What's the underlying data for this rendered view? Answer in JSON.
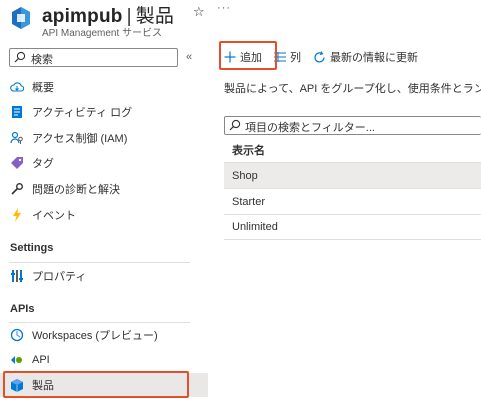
{
  "header": {
    "resource_name": "apimpub",
    "separator": "|",
    "page_name": "製品",
    "subtitle": "API Management サービス",
    "favorite_icon": "star-icon",
    "more_label": "···"
  },
  "sidebar": {
    "search_placeholder": "検索",
    "collapse_label": "«",
    "items_top": [
      {
        "label": "概要",
        "icon": "cloud-icon"
      },
      {
        "label": "アクティビティ ログ",
        "icon": "activity-log-icon"
      },
      {
        "label": "アクセス制御 (IAM)",
        "icon": "iam-icon"
      },
      {
        "label": "タグ",
        "icon": "tag-icon"
      },
      {
        "label": "問題の診断と解決",
        "icon": "wrench-icon"
      },
      {
        "label": "イベント",
        "icon": "lightning-icon"
      }
    ],
    "settings": {
      "heading": "Settings",
      "items": [
        {
          "label": "プロパティ",
          "icon": "properties-icon"
        }
      ]
    },
    "apis": {
      "heading": "APIs",
      "items": [
        {
          "label": "Workspaces (プレビュー)",
          "icon": "workspaces-icon"
        },
        {
          "label": "API",
          "icon": "api-icon"
        },
        {
          "label": "製品",
          "icon": "products-icon",
          "active": true
        }
      ]
    }
  },
  "toolbar": {
    "add_label": "追加",
    "columns_label": "列",
    "refresh_label": "最新の情報に更新"
  },
  "main": {
    "description": "製品によって、API をグループ化し、使用条件とランタイ",
    "filter_placeholder": "項目の検索とフィルター...",
    "table": {
      "column_header": "表示名",
      "rows": [
        {
          "name": "Shop",
          "selected": true
        },
        {
          "name": "Starter",
          "selected": false
        },
        {
          "name": "Unlimited",
          "selected": false
        }
      ]
    }
  },
  "colors": {
    "highlight": "#e2502a",
    "accent": "#0078d4",
    "selected_bg": "#edebe9"
  }
}
